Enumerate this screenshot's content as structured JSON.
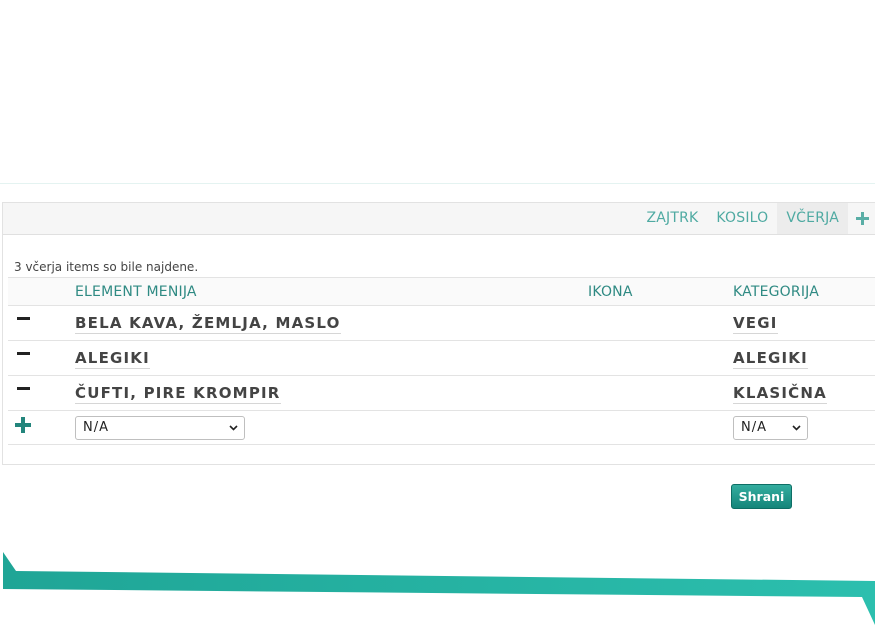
{
  "tabs": [
    {
      "label": "ZAJTRK",
      "active": false
    },
    {
      "label": "KOSILO",
      "active": false
    },
    {
      "label": "VČERJA",
      "active": true
    }
  ],
  "count_text": "3 včerja items so bile najdene.",
  "columns": {
    "name": "ELEMENT MENIJA",
    "icon": "IKONA",
    "category": "KATEGORIJA"
  },
  "rows": [
    {
      "name": "BELA KAVA, ŽEMLJA, MASLO",
      "category": "VEGI"
    },
    {
      "name": "ALEGIKI",
      "category": "ALEGIKI"
    },
    {
      "name": "ČUFTI, PIRE KROMPIR",
      "category": "KLASIČNA"
    }
  ],
  "new_row": {
    "name_select": "N/A",
    "category_select": "N/A"
  },
  "save_label": "Shrani",
  "colors": {
    "accent": "#1a9488",
    "tab_text": "#4faaa2",
    "header_text": "#2f8a83"
  },
  "icons": {
    "tab_add": "plus-icon",
    "remove_row": "minus-icon",
    "add_row": "plus-icon",
    "select": "chevron-down-icon"
  }
}
